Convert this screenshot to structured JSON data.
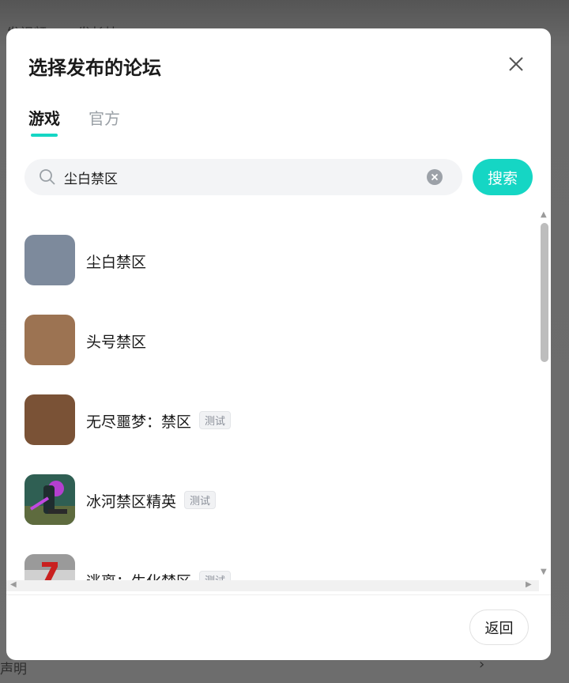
{
  "background": {
    "tabs": [
      "发视频",
      "发长帖"
    ],
    "footer_label": "声明"
  },
  "dialog": {
    "title": "选择发布的论坛",
    "tabs": [
      {
        "label": "游戏",
        "active": true
      },
      {
        "label": "官方",
        "active": false
      }
    ],
    "search": {
      "value": "尘白禁区",
      "search_button_label": "搜索"
    },
    "results": [
      {
        "name": "尘白禁区",
        "badge": "",
        "icon_color": "#7d8a9c"
      },
      {
        "name": "头号禁区",
        "badge": "",
        "icon_color": "#9c7352"
      },
      {
        "name": "无尽噩梦：禁区",
        "badge": "测试",
        "icon_color": "#7a5236"
      },
      {
        "name": "冰河禁区精英",
        "badge": "测试",
        "icon_color": "#3f6e5a"
      },
      {
        "name": "逃离：生化禁区",
        "badge": "测试",
        "icon_color": "#c8c8c8"
      }
    ],
    "back_button_label": "返回"
  },
  "colors": {
    "accent": "#15d6c4",
    "overlay": "#6d6d6d"
  }
}
